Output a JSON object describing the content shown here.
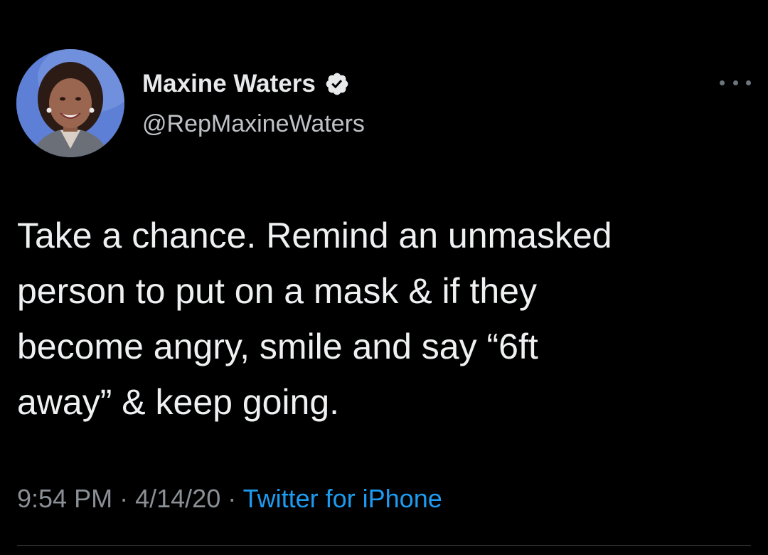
{
  "tweet": {
    "author": {
      "name": "Maxine Waters",
      "handle": "@RepMaxineWaters",
      "verified": true
    },
    "text": "Take a chance. Remind an unmasked\nperson to put on a mask & if they\nbecome angry, smile and say “6ft\naway” & keep going.",
    "time": "9:54 PM",
    "date": "4/14/20",
    "separator": "·",
    "source": "Twitter for iPhone"
  },
  "icons": {
    "verified": "verified-badge-icon",
    "more": "more-options-icon"
  },
  "colors": {
    "background": "#000000",
    "text": "#e7e9ea",
    "secondary": "#8a9096",
    "link": "#1d9bf0",
    "avatar_bg": "#5e7fd6"
  }
}
